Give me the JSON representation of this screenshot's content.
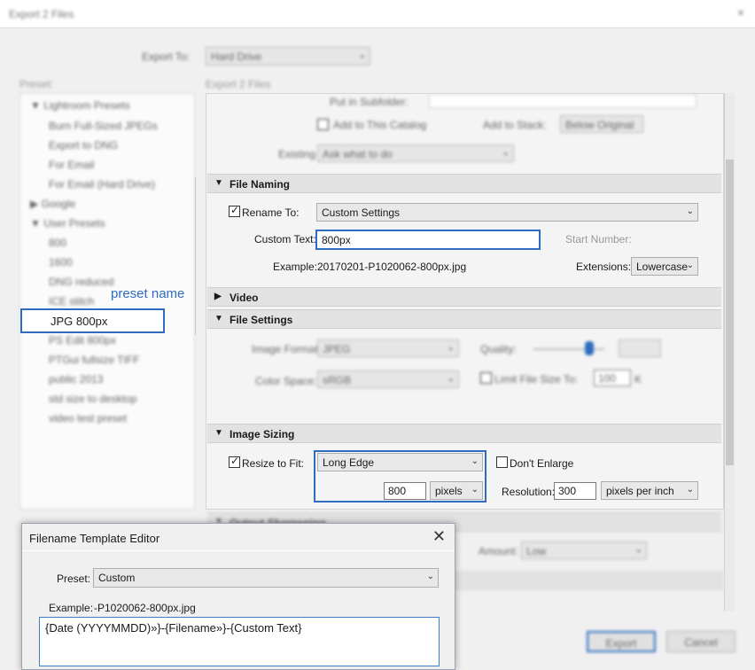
{
  "window": {
    "title": "Export 2 Files",
    "close": "×"
  },
  "export_to": {
    "label": "Export To:",
    "value": "Hard Drive"
  },
  "preset_panel": {
    "label": "Preset:",
    "folders": [
      {
        "name": "Lightroom Presets",
        "arrow": "▼"
      },
      {
        "name": "Google",
        "arrow": "▶"
      },
      {
        "name": "User Presets",
        "arrow": "▼"
      }
    ],
    "lightroom_items": [
      "Burn Full-Sized JPEGs",
      "Export to DNG",
      "For Email",
      "For Email (Hard Drive)"
    ],
    "user_items": [
      "800",
      "1600",
      "DNG reduced",
      "ICE stitch",
      "JPG 800px",
      "PS Edit 800px",
      "PTGui fullsize TIFF",
      "public 2013",
      "std size to desktop",
      "video test preset"
    ],
    "selected": "JPG 800px",
    "annotation": "preset name"
  },
  "settings_panel": {
    "header": "Export 2 Files",
    "put_in_subfolder": "Put in Subfolder:",
    "add_to_catalog": "Add to This Catalog",
    "add_to_stack": "Add to Stack:",
    "stack_position": "Below Original",
    "existing_files_label": "Existing Files:",
    "existing_files_value": "Ask what to do"
  },
  "file_naming": {
    "title": "File Naming",
    "rename_to_label": "Rename To:",
    "rename_to_value": "Custom Settings",
    "custom_text_label": "Custom Text:",
    "custom_text_value": "800px",
    "start_number_label": "Start Number:",
    "example_label": "Example:",
    "example_value": "20170201-P1020062-800px.jpg",
    "extensions_label": "Extensions:",
    "extensions_value": "Lowercase"
  },
  "video": {
    "title": "Video"
  },
  "file_settings": {
    "title": "File Settings",
    "image_format_label": "Image Format:",
    "image_format_value": "JPEG",
    "quality_label": "Quality:",
    "color_space_label": "Color Space:",
    "color_space_value": "sRGB",
    "limit_size_label": "Limit File Size To:",
    "limit_size_value": "100",
    "limit_size_unit": "K"
  },
  "image_sizing": {
    "title": "Image Sizing",
    "resize_label": "Resize to Fit:",
    "resize_mode": "Long Edge",
    "dont_enlarge": "Don't Enlarge",
    "size_value": "800",
    "size_unit": "pixels",
    "resolution_label": "Resolution:",
    "resolution_value": "300",
    "resolution_unit": "pixels per inch"
  },
  "output_sharpening": {
    "title": "Output Sharpening",
    "amount_label": "Amount:",
    "amount_value": "Low"
  },
  "buttons": {
    "export": "Export",
    "cancel": "Cancel"
  },
  "template_editor": {
    "title": "Filename Template Editor",
    "close": "✕",
    "preset_label": "Preset:",
    "preset_value": "Custom",
    "example_label": "Example:",
    "example_value": "-P1020062-800px.jpg",
    "template": "{Date (YYYYMMDD)»}-{Filename»}-{Custom Text}"
  },
  "icons": {
    "chevron": "chevron-down-icon",
    "check": "check-icon",
    "triangle_down": "triangle-down-icon",
    "triangle_right": "triangle-right-icon"
  },
  "colors": {
    "accent": "#2d6cc0",
    "section_bg": "#e2e2e2"
  }
}
